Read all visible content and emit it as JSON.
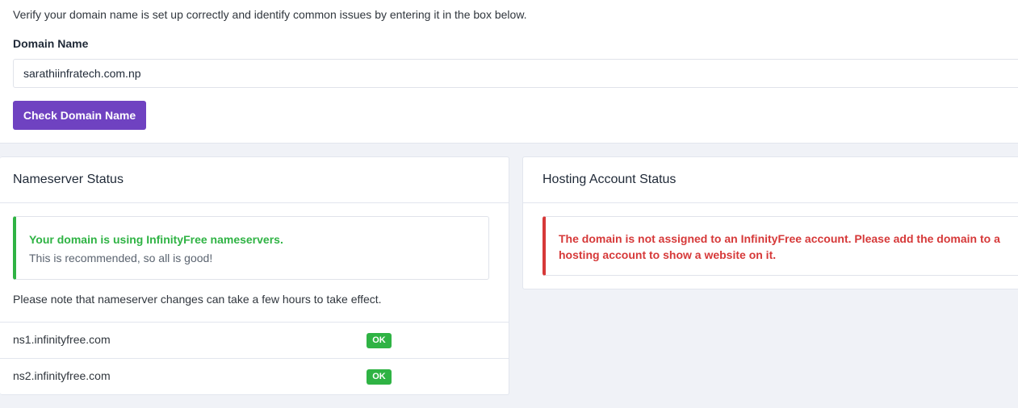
{
  "checker": {
    "intro": "Verify your domain name is set up correctly and identify common issues by entering it in the box below.",
    "domain_label": "Domain Name",
    "domain_value": "sarathiinfratech.com.np",
    "check_button": "Check Domain Name"
  },
  "nameserver_status": {
    "title": "Nameserver Status",
    "alert_title": "Your domain is using InfinityFree nameservers.",
    "alert_text": "This is recommended, so all is good!",
    "note": "Please note that nameserver changes can take a few hours to take effect.",
    "nameservers": [
      {
        "name": "ns1.infinityfree.com",
        "status": "OK"
      },
      {
        "name": "ns2.infinityfree.com",
        "status": "OK"
      }
    ]
  },
  "hosting_status": {
    "title": "Hosting Account Status",
    "alert_text": "The domain is not assigned to an InfinityFree account. Please add the domain to a hosting account to show a website on it."
  },
  "colors": {
    "accent": "#6f42c1",
    "success": "#2fb344",
    "danger": "#d63939"
  }
}
